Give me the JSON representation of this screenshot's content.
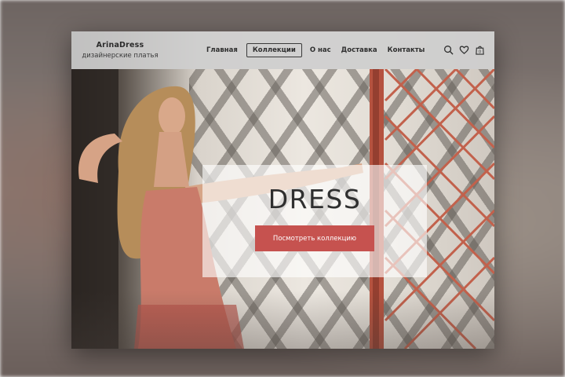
{
  "header": {
    "brand_name": "ArinaDress",
    "brand_tagline": "дизайнерские платья",
    "nav": [
      {
        "label": "Главная",
        "active": false
      },
      {
        "label": "Коллекции",
        "active": true
      },
      {
        "label": "О нас",
        "active": false
      },
      {
        "label": "Доставка",
        "active": false
      },
      {
        "label": "Контакты",
        "active": false
      }
    ],
    "icons": [
      "search-icon",
      "heart-icon",
      "shopping-bag-icon"
    ],
    "cart_count": "0"
  },
  "hero": {
    "title": "DRESS",
    "cta_label": "Посмотреть коллекцию"
  },
  "colors": {
    "accent": "#c6524f",
    "header_bg": "#cecece",
    "text_dark": "#2f2f2f"
  }
}
